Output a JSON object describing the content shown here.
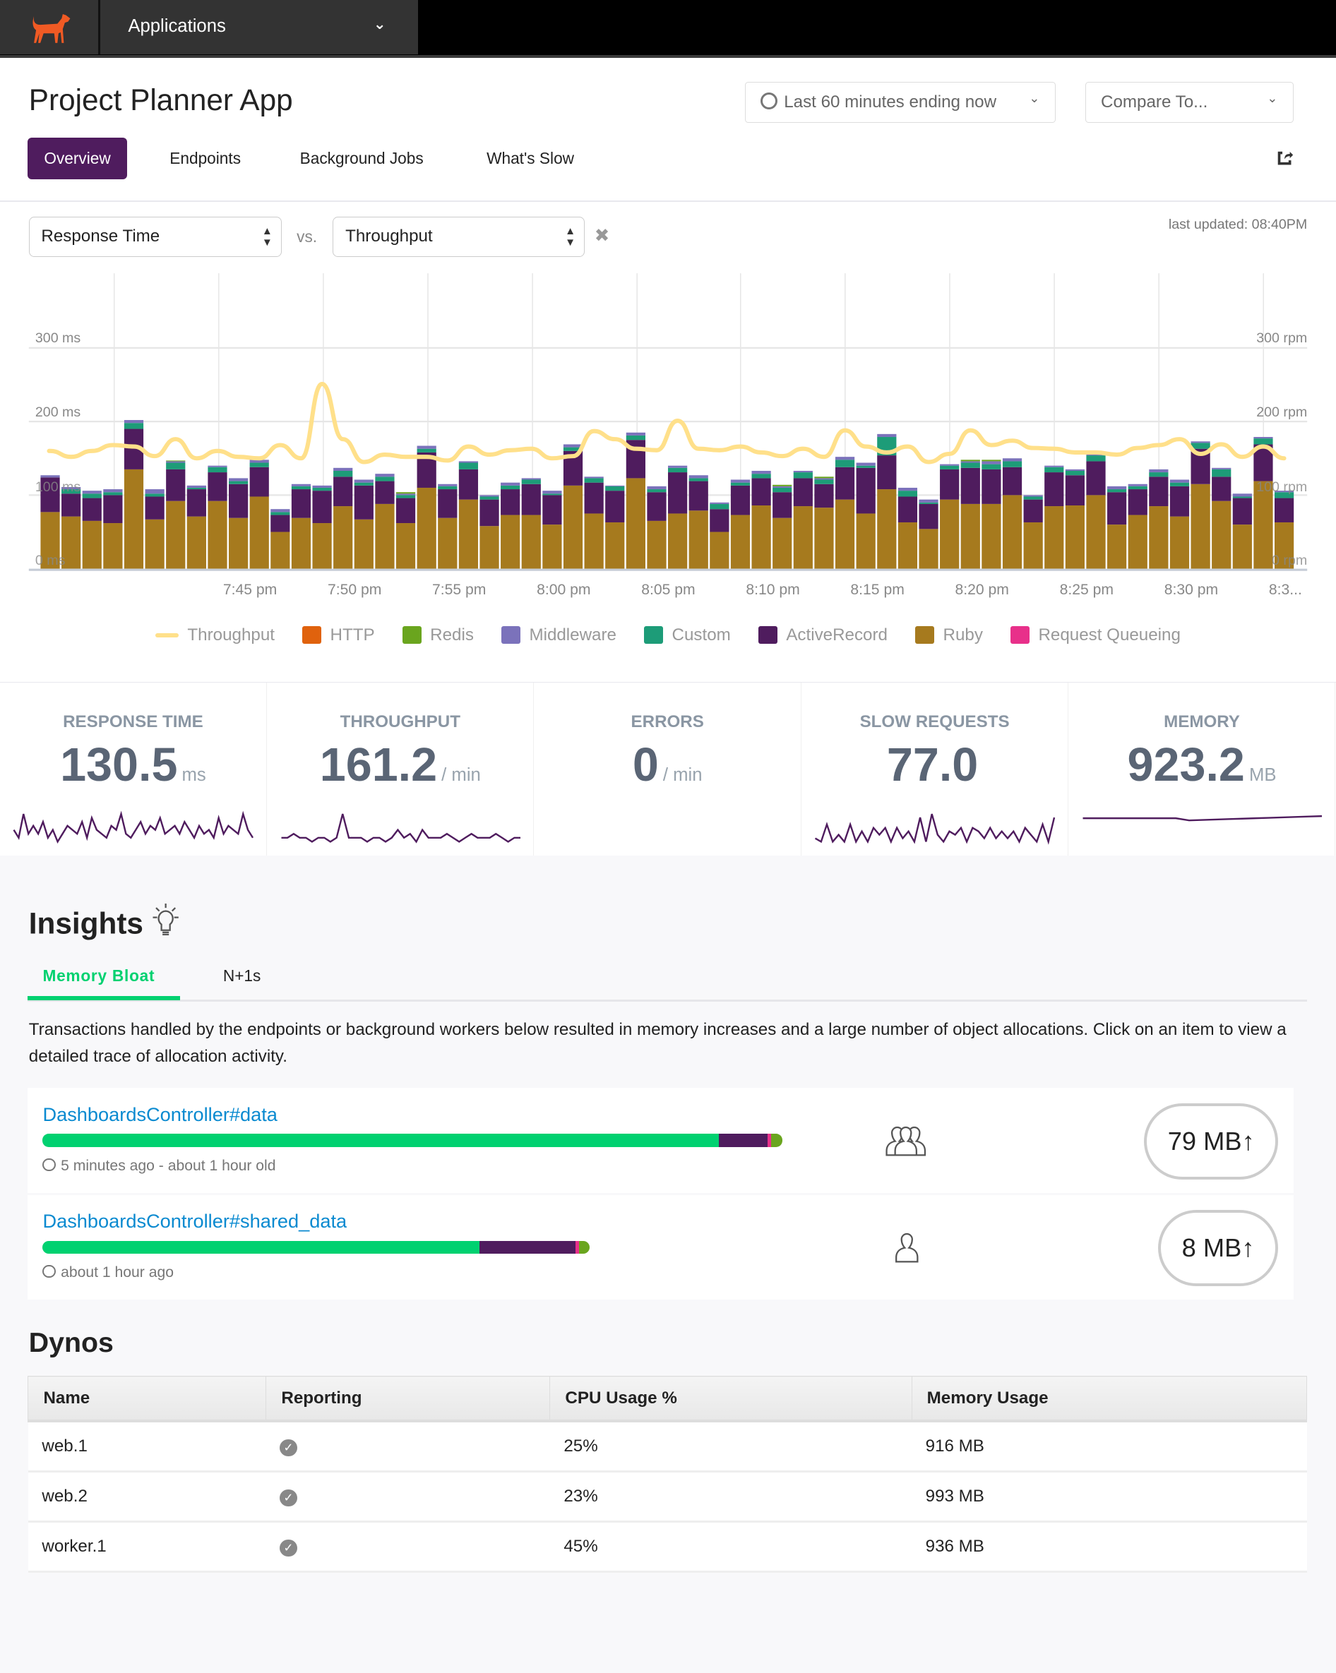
{
  "nav": {
    "app_menu": "Applications",
    "logo": "dog-logo"
  },
  "header": {
    "title": "Project Planner App",
    "time_range": "Last 60 minutes ending now",
    "compare": "Compare To...",
    "tabs": [
      "Overview",
      "Endpoints",
      "Background Jobs",
      "What's Slow"
    ]
  },
  "controls": {
    "metric_left": "Response Time",
    "vs": "vs.",
    "metric_right": "Throughput",
    "last_updated": "last updated: 08:40PM"
  },
  "colors": {
    "Throughput": "#ffe08a",
    "HTTP": "#e0620d",
    "Redis": "#6aa51e",
    "Middleware": "#7b72bb",
    "Custom": "#1d9c78",
    "ActiveRecord": "#4f1c5e",
    "Ruby": "#a67a1e",
    "Request Queueing": "#e8308a",
    "accent": "#4f1c5e",
    "insight_green": "#00d170",
    "link": "#0a8ad0"
  },
  "chart_data": {
    "type": "bar",
    "stacked": true,
    "x_tick_labels": [
      "7:45 pm",
      "7:50 pm",
      "7:55 pm",
      "8:00 pm",
      "8:05 pm",
      "8:10 pm",
      "8:15 pm",
      "8:20 pm",
      "8:25 pm",
      "8:30 pm",
      "8:3..."
    ],
    "y_left": {
      "ticks": [
        "0 ms",
        "100 ms",
        "200 ms",
        "300 ms"
      ],
      "range": [
        0,
        400
      ]
    },
    "y_right": {
      "ticks": [
        "0 rpm",
        "100 rpm",
        "200 rpm",
        "300 rpm"
      ],
      "range": [
        0,
        400
      ]
    },
    "grid": true,
    "legend": [
      "Throughput",
      "HTTP",
      "Redis",
      "Middleware",
      "Custom",
      "ActiveRecord",
      "Ruby",
      "Request Queueing"
    ],
    "legend_position": "bottom",
    "series": [
      {
        "name": "Ruby",
        "values": [
          77,
          71,
          65,
          62,
          135,
          67,
          92,
          71,
          92,
          69,
          98,
          50,
          69,
          62,
          85,
          67,
          88,
          62,
          110,
          69,
          94,
          58,
          73,
          73,
          60,
          113,
          75,
          63,
          123,
          65,
          75,
          79,
          50,
          73,
          86,
          69,
          85,
          83,
          94,
          75,
          108,
          63,
          54,
          94,
          88,
          88,
          100,
          63,
          85,
          86,
          100,
          60,
          73,
          85,
          71,
          115,
          92,
          60,
          119,
          63
        ]
      },
      {
        "name": "ActiveRecord",
        "values": [
          47,
          31,
          31,
          38,
          55,
          31,
          43,
          37,
          39,
          46,
          40,
          23,
          39,
          44,
          40,
          46,
          31,
          34,
          48,
          39,
          41,
          36,
          35,
          42,
          40,
          47,
          42,
          43,
          52,
          39,
          56,
          40,
          31,
          40,
          37,
          35,
          38,
          32,
          44,
          62,
          46,
          35,
          34,
          41,
          49,
          47,
          38,
          31,
          46,
          41,
          46,
          44,
          35,
          40,
          41,
          48,
          33,
          36,
          50,
          33
        ]
      },
      {
        "name": "Custom",
        "values": [
          0,
          6,
          6,
          4,
          8,
          4,
          9,
          2,
          7,
          4,
          6,
          4,
          4,
          4,
          8,
          4,
          6,
          4,
          5,
          4,
          9,
          4,
          5,
          6,
          2,
          5,
          6,
          6,
          6,
          4,
          6,
          4,
          7,
          4,
          6,
          6,
          8,
          6,
          10,
          3,
          25,
          8,
          2,
          5,
          7,
          7,
          8,
          4,
          7,
          6,
          8,
          4,
          4,
          6,
          5,
          8,
          10,
          2,
          8,
          8
        ]
      },
      {
        "name": "Middleware",
        "values": [
          3,
          3,
          4,
          4,
          4,
          6,
          2,
          3,
          2,
          4,
          4,
          4,
          3,
          3,
          4,
          4,
          4,
          2,
          4,
          3,
          2,
          2,
          4,
          2,
          4,
          4,
          2,
          1,
          4,
          4,
          3,
          4,
          2,
          4,
          4,
          2,
          2,
          2,
          4,
          4,
          4,
          4,
          4,
          2,
          2,
          4,
          4,
          2,
          2,
          2,
          4,
          4,
          3,
          4,
          4,
          2,
          2,
          4,
          2,
          2
        ]
      },
      {
        "name": "Redis",
        "values": [
          0,
          0,
          0,
          0,
          0,
          0,
          1,
          0,
          0,
          0,
          0,
          0,
          0,
          0,
          0,
          0,
          0,
          2,
          0,
          0,
          0,
          0,
          0,
          0,
          0,
          0,
          0,
          0,
          0,
          0,
          0,
          0,
          0,
          0,
          0,
          2,
          0,
          2,
          0,
          0,
          0,
          0,
          0,
          0,
          2,
          2,
          0,
          0,
          0,
          0,
          0,
          0,
          0,
          0,
          0,
          0,
          0,
          0,
          0,
          0
        ]
      },
      {
        "name": "Throughput",
        "type": "line",
        "axis": "right",
        "values": [
          160,
          152,
          160,
          168,
          166,
          153,
          176,
          150,
          160,
          152,
          150,
          168,
          150,
          251,
          176,
          145,
          155,
          152,
          152,
          147,
          166,
          155,
          161,
          163,
          150,
          153,
          187,
          176,
          163,
          161,
          201,
          163,
          161,
          166,
          158,
          153,
          163,
          152,
          188,
          166,
          158,
          166,
          145,
          156,
          188,
          168,
          174,
          164,
          163,
          158,
          158,
          155,
          164,
          168,
          176,
          156,
          169,
          152,
          166,
          150
        ]
      }
    ]
  },
  "stats": [
    {
      "label": "RESPONSE TIME",
      "value": "130.5",
      "unit": "ms",
      "spark": [
        5,
        3,
        9,
        4,
        6,
        4,
        7,
        3,
        5,
        2,
        4,
        6,
        5,
        4,
        7,
        3,
        8,
        5,
        4,
        3,
        6,
        5,
        9,
        4,
        3,
        5,
        7,
        4,
        6,
        5,
        8,
        4,
        5,
        6,
        4,
        7,
        5,
        3,
        6,
        4,
        5,
        3,
        8,
        4,
        6,
        5,
        4,
        9,
        5,
        3
      ]
    },
    {
      "label": "THROUGHPUT",
      "value": "161.2",
      "unit": "/ min",
      "spark": [
        3,
        3,
        4,
        3,
        3,
        2,
        3,
        3,
        2,
        3,
        9,
        3,
        3,
        3,
        2,
        3,
        3,
        2,
        3,
        5,
        3,
        4,
        2,
        5,
        3,
        3,
        3,
        4,
        3,
        2,
        3,
        4,
        3,
        3,
        3,
        4,
        3,
        2,
        3,
        3
      ]
    },
    {
      "label": "ERRORS",
      "value": "0",
      "unit": "/ min",
      "spark": []
    },
    {
      "label": "SLOW REQUESTS",
      "value": "77.0",
      "unit": "",
      "spark": [
        2,
        1,
        6,
        1,
        3,
        1,
        6,
        1,
        4,
        1,
        5,
        3,
        5,
        1,
        5,
        2,
        4,
        1,
        8,
        1,
        9,
        3,
        1,
        4,
        3,
        5,
        1,
        5,
        4,
        2,
        5,
        2,
        4,
        2,
        4,
        1,
        5,
        3,
        1,
        6,
        1,
        8
      ]
    },
    {
      "label": "MEMORY",
      "value": "923.2",
      "unit": "MB",
      "spark": [
        5,
        5,
        5,
        5,
        5,
        5,
        5,
        5,
        4.5,
        4.6,
        4.7,
        4.8,
        4.9,
        5,
        5.1,
        5.2,
        5.3,
        5.4,
        5.5
      ]
    }
  ],
  "insights": {
    "title": "Insights",
    "tabs": [
      "Memory Bloat",
      "N+1s"
    ],
    "description": "Transactions handled by the endpoints or background workers below resulted in memory increases and a large number of object allocations. Click on an item to view a detailed trace of allocation activity.",
    "items": [
      {
        "name": "DashboardsController#data",
        "meta": "5 minutes ago - about 1 hour old",
        "users_icon": "users-icon",
        "memory": "79 MB",
        "bar_scale": 1.0,
        "segments": [
          {
            "color": "#00d170",
            "pct": 91.4
          },
          {
            "color": "#4f1c5e",
            "pct": 6.6
          },
          {
            "color": "#e8308a",
            "pct": 0.5
          },
          {
            "color": "#6aa51e",
            "pct": 1.5
          }
        ]
      },
      {
        "name": "DashboardsController#shared_data",
        "meta": "about 1 hour ago",
        "users_icon": "user-icon",
        "memory": "8 MB",
        "bar_scale": 0.74,
        "segments": [
          {
            "color": "#00d170",
            "pct": 79.8
          },
          {
            "color": "#4f1c5e",
            "pct": 17.6
          },
          {
            "color": "#e8308a",
            "pct": 0.6
          },
          {
            "color": "#6aa51e",
            "pct": 2.0
          }
        ]
      }
    ]
  },
  "dynos": {
    "title": "Dynos",
    "columns": [
      "Name",
      "Reporting",
      "CPU Usage %",
      "Memory Usage"
    ],
    "rows": [
      {
        "name": "web.1",
        "cpu": "25%",
        "mem": "916 MB"
      },
      {
        "name": "web.2",
        "cpu": "23%",
        "mem": "993 MB"
      },
      {
        "name": "worker.1",
        "cpu": "45%",
        "mem": "936 MB"
      }
    ]
  }
}
